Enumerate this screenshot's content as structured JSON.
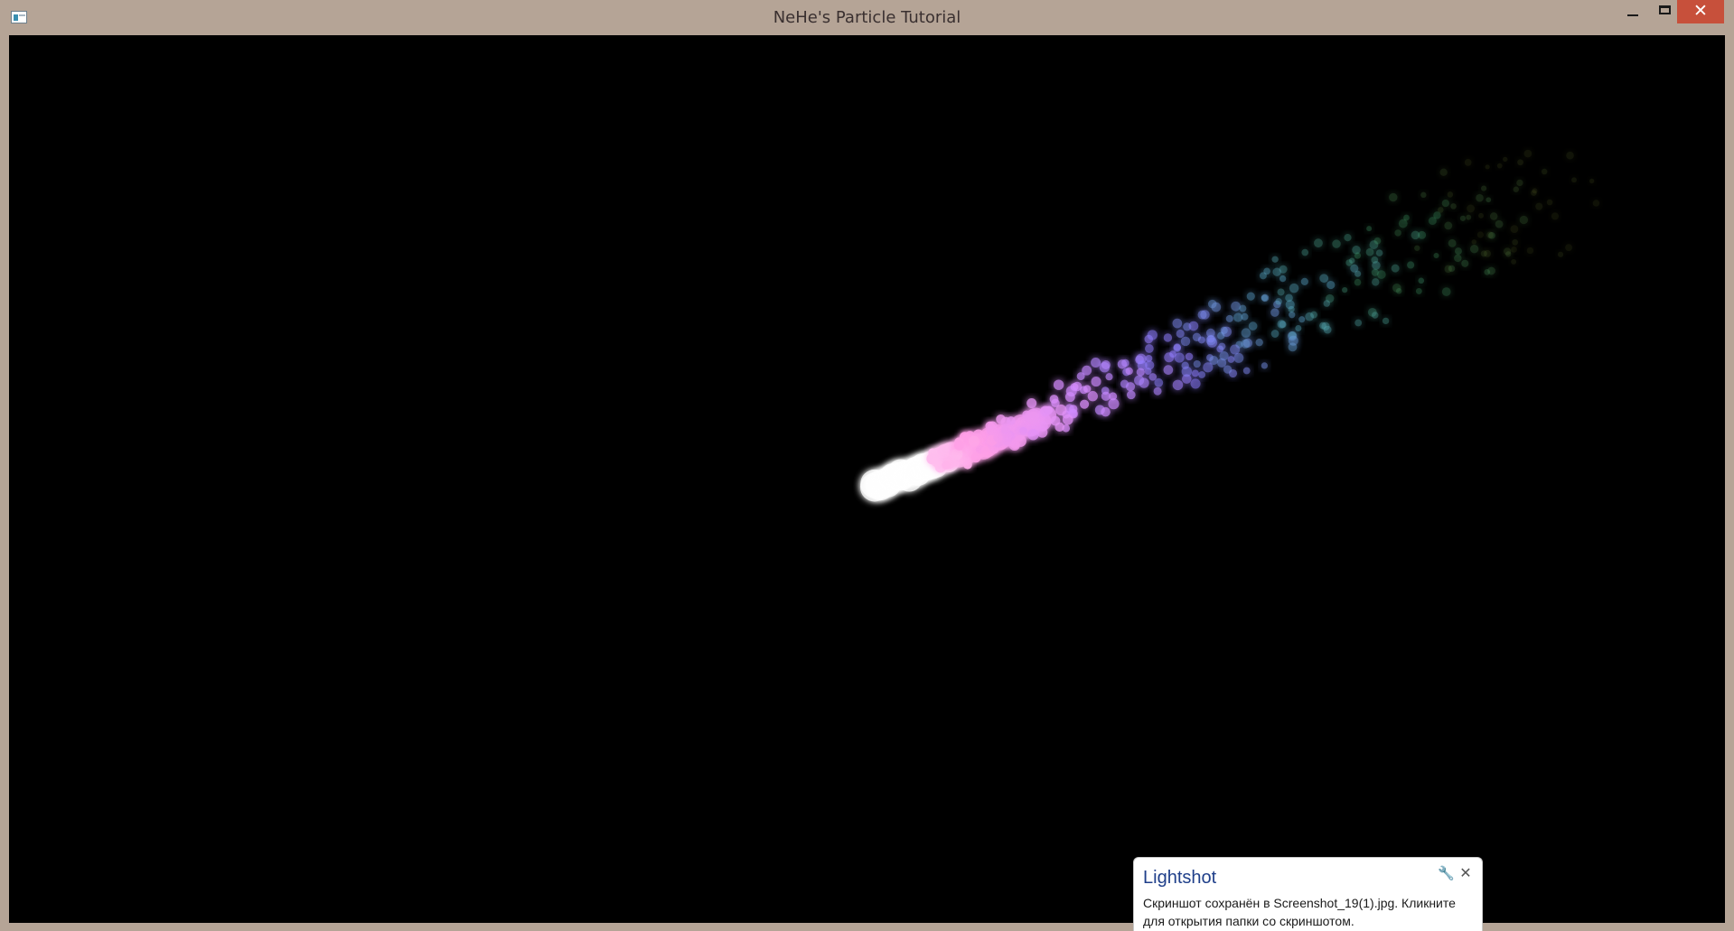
{
  "window": {
    "title": "NeHe's Particle Tutorial",
    "controls": {
      "minimize": "minimize-icon",
      "maximize": "maximize-icon",
      "close": "close-icon",
      "close_glyph": "✕"
    },
    "icon": "app-window-icon"
  },
  "scene": {
    "background_color": "#000000",
    "gradient_colors": [
      "#ffffff",
      "#ff9fe6",
      "#d68cff",
      "#8c7dff",
      "#5fb4d6",
      "#4fbf7e",
      "#8a9a3a"
    ]
  },
  "notification": {
    "title": "Lightshot",
    "message": "Скриншот сохранён в Screenshot_19(1).jpg. Кликните для открытия папки со скриншотом.",
    "settings_icon": "wrench-icon",
    "settings_glyph": "🔧",
    "close_icon": "close-icon",
    "close_glyph": "✕"
  }
}
